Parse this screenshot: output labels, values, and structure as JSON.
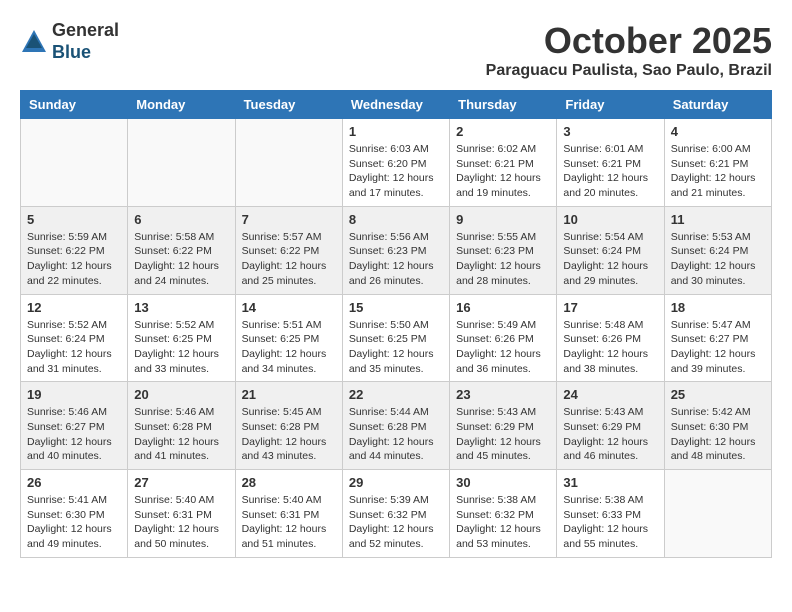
{
  "header": {
    "logo_line1": "General",
    "logo_line2": "Blue",
    "month_title": "October 2025",
    "location": "Paraguacu Paulista, Sao Paulo, Brazil"
  },
  "weekdays": [
    "Sunday",
    "Monday",
    "Tuesday",
    "Wednesday",
    "Thursday",
    "Friday",
    "Saturday"
  ],
  "weeks": [
    [
      {
        "day": "",
        "empty": true
      },
      {
        "day": "",
        "empty": true
      },
      {
        "day": "",
        "empty": true
      },
      {
        "day": "1",
        "sunrise": "Sunrise: 6:03 AM",
        "sunset": "Sunset: 6:20 PM",
        "daylight": "Daylight: 12 hours and 17 minutes."
      },
      {
        "day": "2",
        "sunrise": "Sunrise: 6:02 AM",
        "sunset": "Sunset: 6:21 PM",
        "daylight": "Daylight: 12 hours and 19 minutes."
      },
      {
        "day": "3",
        "sunrise": "Sunrise: 6:01 AM",
        "sunset": "Sunset: 6:21 PM",
        "daylight": "Daylight: 12 hours and 20 minutes."
      },
      {
        "day": "4",
        "sunrise": "Sunrise: 6:00 AM",
        "sunset": "Sunset: 6:21 PM",
        "daylight": "Daylight: 12 hours and 21 minutes."
      }
    ],
    [
      {
        "day": "5",
        "sunrise": "Sunrise: 5:59 AM",
        "sunset": "Sunset: 6:22 PM",
        "daylight": "Daylight: 12 hours and 22 minutes."
      },
      {
        "day": "6",
        "sunrise": "Sunrise: 5:58 AM",
        "sunset": "Sunset: 6:22 PM",
        "daylight": "Daylight: 12 hours and 24 minutes."
      },
      {
        "day": "7",
        "sunrise": "Sunrise: 5:57 AM",
        "sunset": "Sunset: 6:22 PM",
        "daylight": "Daylight: 12 hours and 25 minutes."
      },
      {
        "day": "8",
        "sunrise": "Sunrise: 5:56 AM",
        "sunset": "Sunset: 6:23 PM",
        "daylight": "Daylight: 12 hours and 26 minutes."
      },
      {
        "day": "9",
        "sunrise": "Sunrise: 5:55 AM",
        "sunset": "Sunset: 6:23 PM",
        "daylight": "Daylight: 12 hours and 28 minutes."
      },
      {
        "day": "10",
        "sunrise": "Sunrise: 5:54 AM",
        "sunset": "Sunset: 6:24 PM",
        "daylight": "Daylight: 12 hours and 29 minutes."
      },
      {
        "day": "11",
        "sunrise": "Sunrise: 5:53 AM",
        "sunset": "Sunset: 6:24 PM",
        "daylight": "Daylight: 12 hours and 30 minutes."
      }
    ],
    [
      {
        "day": "12",
        "sunrise": "Sunrise: 5:52 AM",
        "sunset": "Sunset: 6:24 PM",
        "daylight": "Daylight: 12 hours and 31 minutes."
      },
      {
        "day": "13",
        "sunrise": "Sunrise: 5:52 AM",
        "sunset": "Sunset: 6:25 PM",
        "daylight": "Daylight: 12 hours and 33 minutes."
      },
      {
        "day": "14",
        "sunrise": "Sunrise: 5:51 AM",
        "sunset": "Sunset: 6:25 PM",
        "daylight": "Daylight: 12 hours and 34 minutes."
      },
      {
        "day": "15",
        "sunrise": "Sunrise: 5:50 AM",
        "sunset": "Sunset: 6:25 PM",
        "daylight": "Daylight: 12 hours and 35 minutes."
      },
      {
        "day": "16",
        "sunrise": "Sunrise: 5:49 AM",
        "sunset": "Sunset: 6:26 PM",
        "daylight": "Daylight: 12 hours and 36 minutes."
      },
      {
        "day": "17",
        "sunrise": "Sunrise: 5:48 AM",
        "sunset": "Sunset: 6:26 PM",
        "daylight": "Daylight: 12 hours and 38 minutes."
      },
      {
        "day": "18",
        "sunrise": "Sunrise: 5:47 AM",
        "sunset": "Sunset: 6:27 PM",
        "daylight": "Daylight: 12 hours and 39 minutes."
      }
    ],
    [
      {
        "day": "19",
        "sunrise": "Sunrise: 5:46 AM",
        "sunset": "Sunset: 6:27 PM",
        "daylight": "Daylight: 12 hours and 40 minutes."
      },
      {
        "day": "20",
        "sunrise": "Sunrise: 5:46 AM",
        "sunset": "Sunset: 6:28 PM",
        "daylight": "Daylight: 12 hours and 41 minutes."
      },
      {
        "day": "21",
        "sunrise": "Sunrise: 5:45 AM",
        "sunset": "Sunset: 6:28 PM",
        "daylight": "Daylight: 12 hours and 43 minutes."
      },
      {
        "day": "22",
        "sunrise": "Sunrise: 5:44 AM",
        "sunset": "Sunset: 6:28 PM",
        "daylight": "Daylight: 12 hours and 44 minutes."
      },
      {
        "day": "23",
        "sunrise": "Sunrise: 5:43 AM",
        "sunset": "Sunset: 6:29 PM",
        "daylight": "Daylight: 12 hours and 45 minutes."
      },
      {
        "day": "24",
        "sunrise": "Sunrise: 5:43 AM",
        "sunset": "Sunset: 6:29 PM",
        "daylight": "Daylight: 12 hours and 46 minutes."
      },
      {
        "day": "25",
        "sunrise": "Sunrise: 5:42 AM",
        "sunset": "Sunset: 6:30 PM",
        "daylight": "Daylight: 12 hours and 48 minutes."
      }
    ],
    [
      {
        "day": "26",
        "sunrise": "Sunrise: 5:41 AM",
        "sunset": "Sunset: 6:30 PM",
        "daylight": "Daylight: 12 hours and 49 minutes."
      },
      {
        "day": "27",
        "sunrise": "Sunrise: 5:40 AM",
        "sunset": "Sunset: 6:31 PM",
        "daylight": "Daylight: 12 hours and 50 minutes."
      },
      {
        "day": "28",
        "sunrise": "Sunrise: 5:40 AM",
        "sunset": "Sunset: 6:31 PM",
        "daylight": "Daylight: 12 hours and 51 minutes."
      },
      {
        "day": "29",
        "sunrise": "Sunrise: 5:39 AM",
        "sunset": "Sunset: 6:32 PM",
        "daylight": "Daylight: 12 hours and 52 minutes."
      },
      {
        "day": "30",
        "sunrise": "Sunrise: 5:38 AM",
        "sunset": "Sunset: 6:32 PM",
        "daylight": "Daylight: 12 hours and 53 minutes."
      },
      {
        "day": "31",
        "sunrise": "Sunrise: 5:38 AM",
        "sunset": "Sunset: 6:33 PM",
        "daylight": "Daylight: 12 hours and 55 minutes."
      },
      {
        "day": "",
        "empty": true
      }
    ]
  ]
}
